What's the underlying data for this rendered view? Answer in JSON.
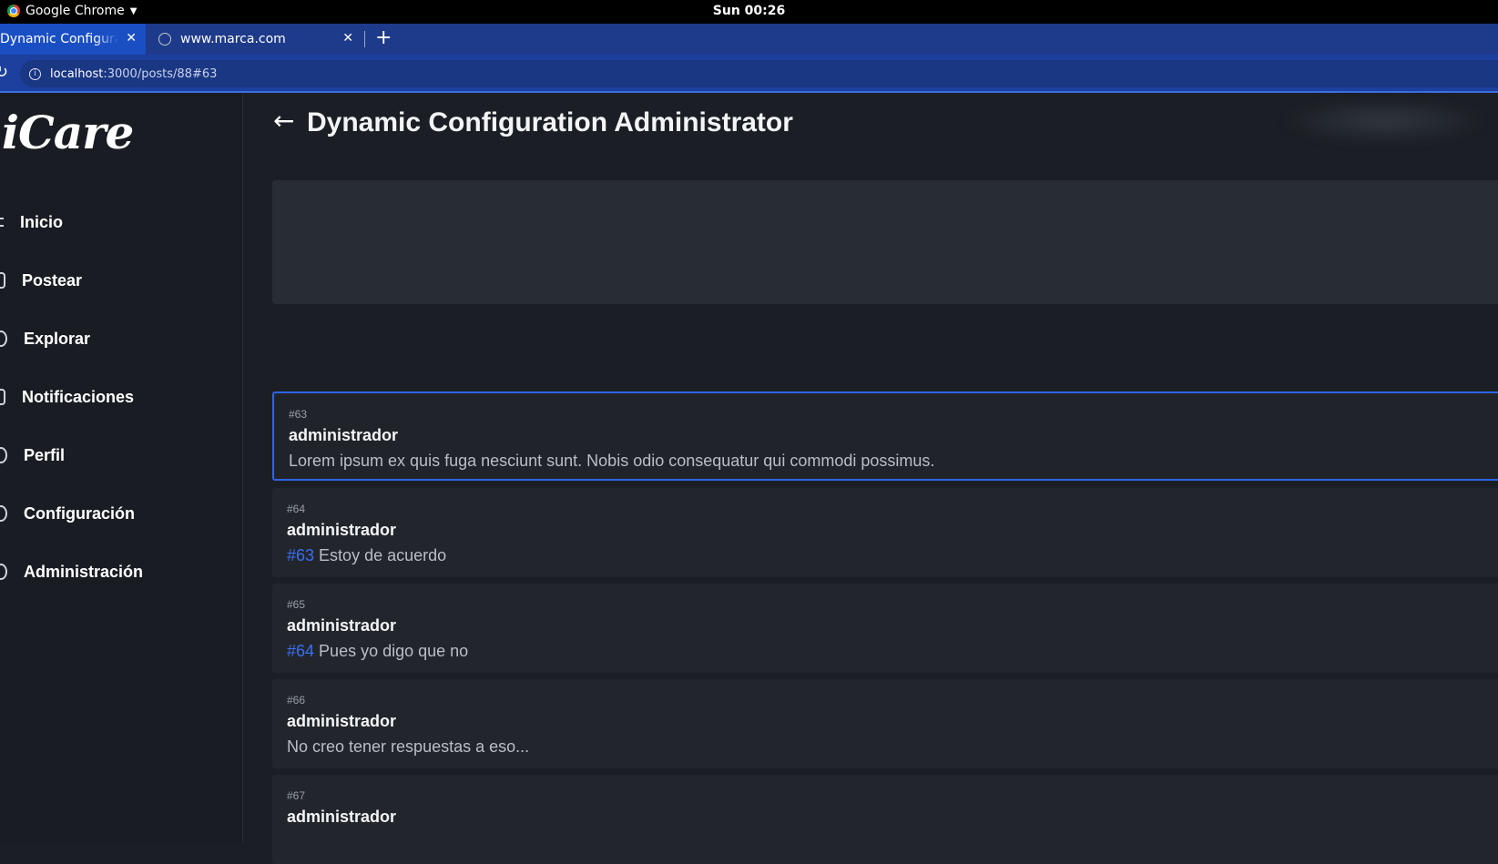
{
  "os": {
    "app_name": "Google Chrome",
    "clock": "Sun 00:26"
  },
  "browser": {
    "tabs": [
      {
        "title": "Dynamic Configuration Administrator",
        "active": true
      },
      {
        "title": "www.marca.com",
        "active": false
      }
    ],
    "url_host": "localhost",
    "url_rest": ":3000/posts/88#63"
  },
  "sidebar": {
    "logo": "iCare",
    "items": [
      {
        "label": "Inicio",
        "icon": "home-icon"
      },
      {
        "label": "Postear",
        "icon": "post-icon"
      },
      {
        "label": "Explorar",
        "icon": "compass-icon"
      },
      {
        "label": "Notificaciones",
        "icon": "bell-icon"
      },
      {
        "label": "Perfil",
        "icon": "user-icon"
      },
      {
        "label": "Configuración",
        "icon": "gear-icon"
      },
      {
        "label": "Administración",
        "icon": "admin-icon"
      }
    ]
  },
  "main": {
    "title": "Dynamic Configuration Administrator",
    "posts": [
      {
        "num": "#63",
        "author": "administrador",
        "ref": "",
        "text": "Lorem ipsum ex quis fuga nesciunt sunt. Nobis odio consequatur qui commodi possimus.",
        "highlighted": true
      },
      {
        "num": "#64",
        "author": "administrador",
        "ref": "#63",
        "text": " Estoy de acuerdo"
      },
      {
        "num": "#65",
        "author": "administrador",
        "ref": "#64",
        "text": " Pues yo digo que no"
      },
      {
        "num": "#66",
        "author": "administrador",
        "ref": "",
        "text": "No creo tener respuestas a eso..."
      },
      {
        "num": "#67",
        "author": "administrador",
        "ref": "",
        "text": ""
      }
    ]
  },
  "colors": {
    "accent": "#2f63e8",
    "tab_bar": "#1e3a8a",
    "sidebar_bg": "#191d23",
    "card_bg": "#22262c"
  }
}
